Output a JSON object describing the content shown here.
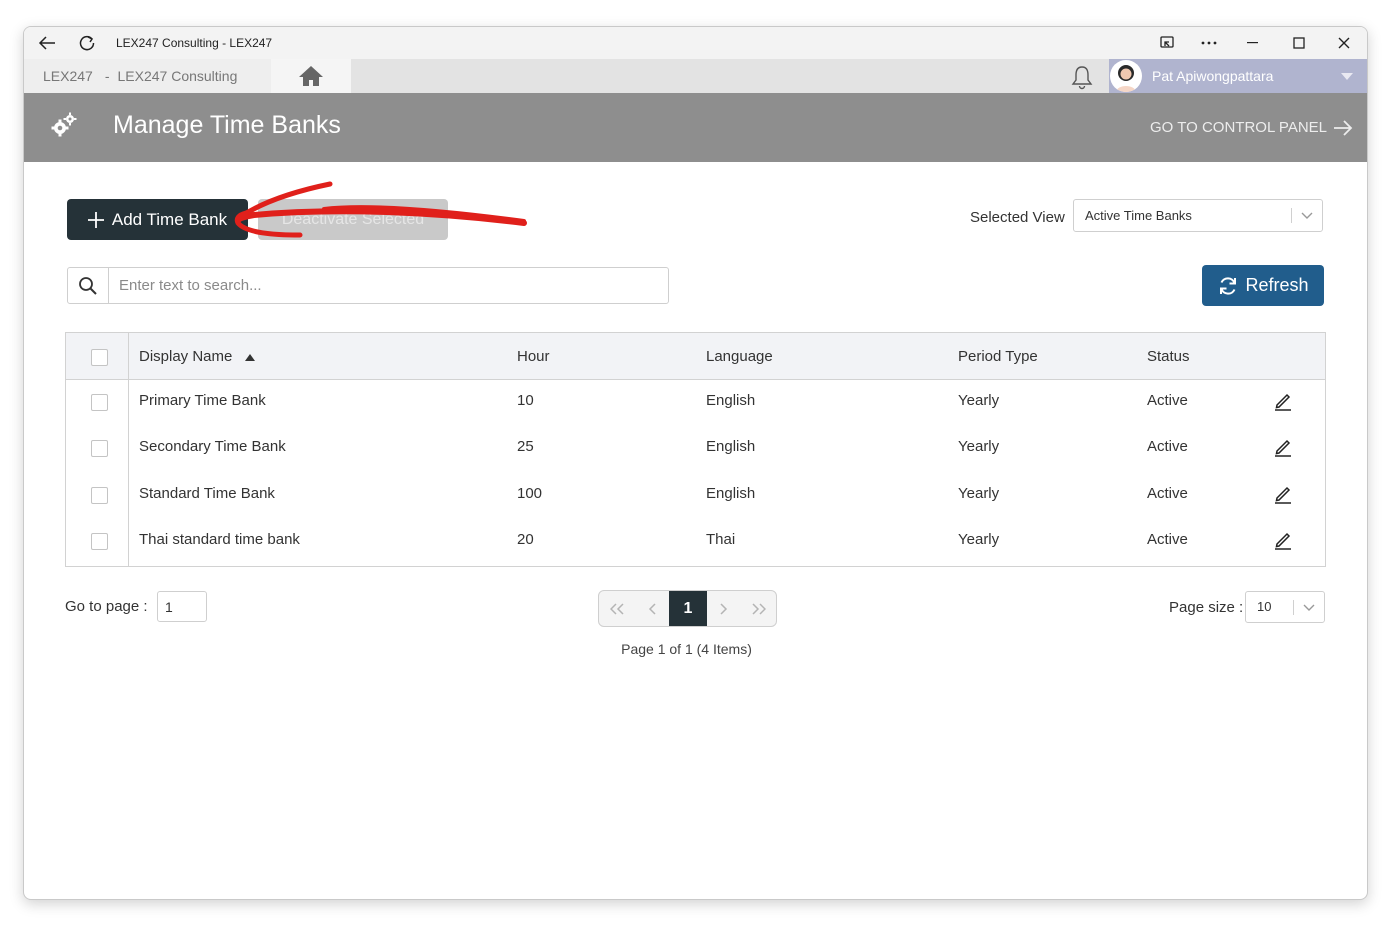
{
  "titlebar": {
    "title": "LEX247 Consulting - LEX247",
    "back_icon": "arrow-left-icon",
    "refresh_icon": "reload-icon"
  },
  "appbar": {
    "tenant_left": "LEX247",
    "tenant_sep": "-",
    "tenant_right": "LEX247 Consulting",
    "user_name": "Pat Apiwongpattara"
  },
  "header": {
    "title": "Manage Time Banks",
    "goto_label": "GO TO CONTROL PANEL"
  },
  "toolbar": {
    "add_label": "Add Time Bank",
    "deactivate_label": "Deactivate Selected",
    "selected_view_label": "Selected View",
    "selected_view_value": "Active Time Banks",
    "refresh_label": "Refresh"
  },
  "search": {
    "placeholder": "Enter text to search..."
  },
  "grid": {
    "columns": [
      "Display Name",
      "Hour",
      "Language",
      "Period Type",
      "Status"
    ],
    "rows": [
      {
        "name": "Primary Time Bank",
        "hour": "10",
        "language": "English",
        "period": "Yearly",
        "status": "Active"
      },
      {
        "name": "Secondary Time Bank",
        "hour": "25",
        "language": "English",
        "period": "Yearly",
        "status": "Active"
      },
      {
        "name": "Standard Time Bank",
        "hour": "100",
        "language": "English",
        "period": "Yearly",
        "status": "Active"
      },
      {
        "name": "Thai standard time bank",
        "hour": "20",
        "language": "Thai",
        "period": "Yearly",
        "status": "Active"
      }
    ]
  },
  "pagination": {
    "goto_label": "Go to page :",
    "goto_value": "1",
    "current_page": "1",
    "info": "Page 1 of 1 (4 Items)",
    "page_size_label": "Page size :",
    "page_size_value": "10"
  },
  "colors": {
    "header_bg": "#8e8e8e",
    "primary_dark": "#253238",
    "refresh_blue": "#215d8c",
    "annotation_red": "#e0201b",
    "user_bar": "#b0b4cf"
  }
}
